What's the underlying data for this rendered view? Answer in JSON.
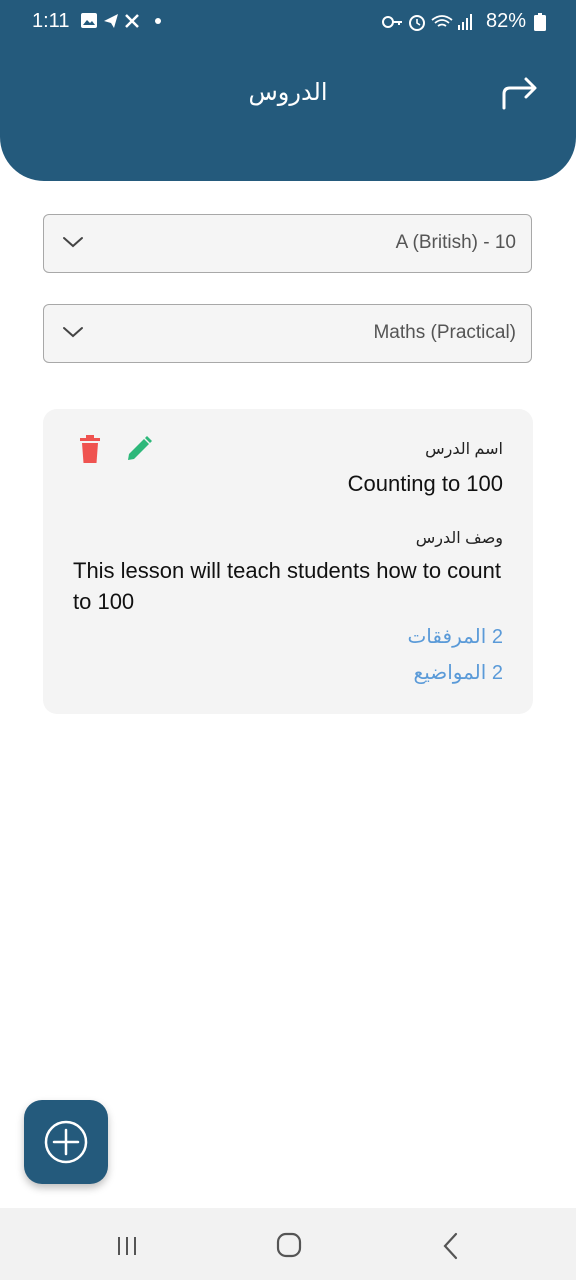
{
  "status_bar": {
    "time": "1:11",
    "battery": "82%"
  },
  "header": {
    "title": "الدروس",
    "forward_icon": "share-forward-icon"
  },
  "filters": {
    "class_select": "A (British) - 10",
    "subject_select": "Maths (Practical)"
  },
  "lesson_card": {
    "name_label": "اسم الدرس",
    "name_value": "Counting to 100",
    "description_label": "وصف الدرس",
    "description_value": "This lesson will teach students how to count to 100",
    "attachments_link": "2 المرفقات",
    "topics_link": "2 المواضيع"
  },
  "colors": {
    "primary": "#245a7c",
    "delete": "#ef5350",
    "edit": "#2db87a",
    "link": "#5a9ad8"
  },
  "fab": {
    "icon": "plus-circle-icon"
  }
}
